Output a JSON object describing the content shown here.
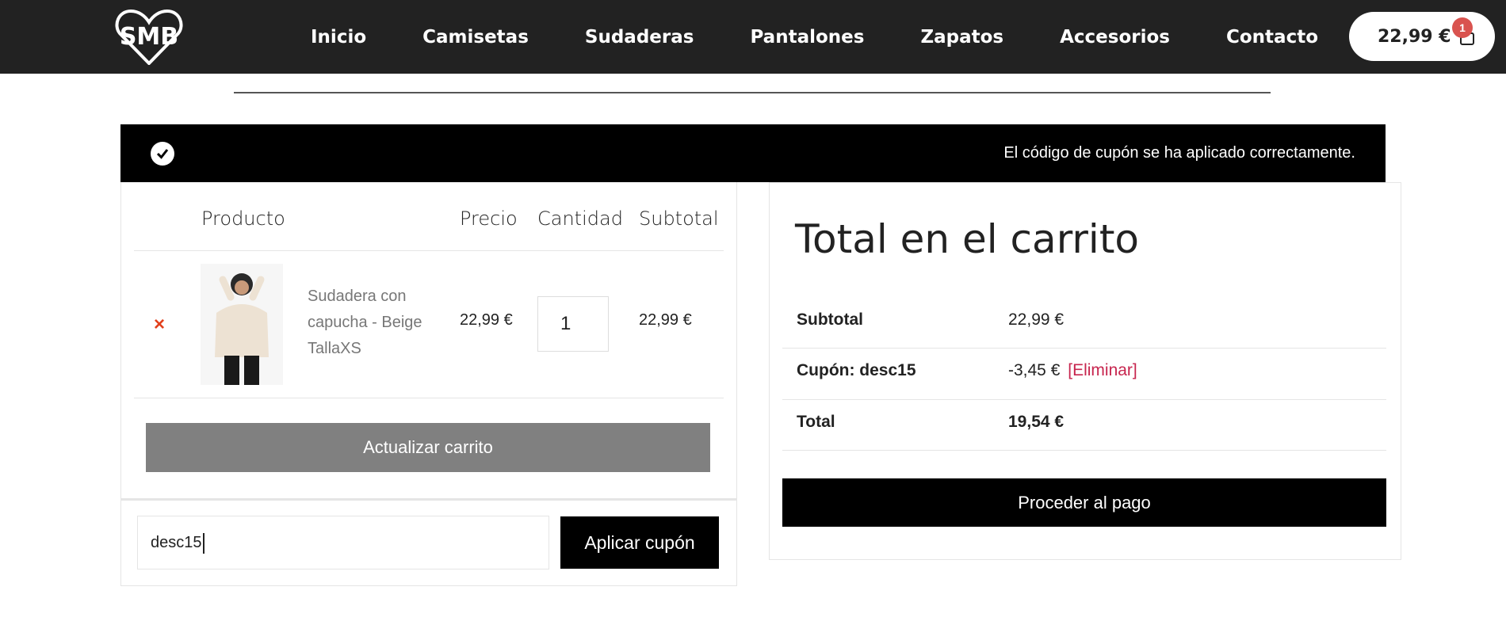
{
  "header": {
    "nav": [
      "Inicio",
      "Camisetas",
      "Sudaderas",
      "Pantalones",
      "Zapatos",
      "Accesorios",
      "Contacto"
    ],
    "cart_total": "22,99 €",
    "cart_count": "1"
  },
  "notice": {
    "text": "El código de cupón se ha aplicado correctamente."
  },
  "cart": {
    "columns": {
      "product": "Producto",
      "price": "Precio",
      "quantity": "Cantidad",
      "subtotal": "Subtotal"
    },
    "items": [
      {
        "remove": "×",
        "name": "Sudadera con capucha - Beige TallaXS",
        "price": "22,99 €",
        "quantity": "1",
        "subtotal": "22,99 €"
      }
    ],
    "update_label": "Actualizar carrito",
    "coupon": {
      "value": "desc15",
      "apply_label": "Aplicar cupón"
    }
  },
  "totals": {
    "title": "Total en el carrito",
    "subtotal_label": "Subtotal",
    "subtotal_value": "22,99 €",
    "coupon_label": "Cupón: desc15",
    "coupon_value": "-3,45 €",
    "coupon_remove": "[Eliminar]",
    "total_label": "Total",
    "total_value": "19,54 €",
    "checkout_label": "Proceder al pago"
  },
  "colors": {
    "header_bg": "#222222",
    "badge": "#d9534f",
    "remove_link": "#c7254e",
    "update_button": "#808080"
  },
  "icons": {
    "logo": "smb-logo",
    "cart": "shopping-bag-icon",
    "notice": "check-circle-icon",
    "remove": "close-icon"
  }
}
